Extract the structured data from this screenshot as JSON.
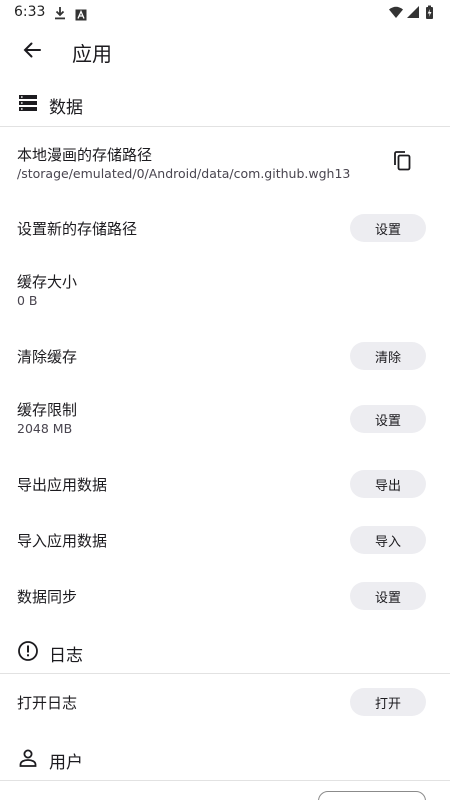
{
  "status_bar": {
    "time": "6:33"
  },
  "app_bar": {
    "title": "应用"
  },
  "sections": {
    "data": {
      "title": "数据"
    },
    "log": {
      "title": "日志"
    },
    "user": {
      "title": "用户"
    }
  },
  "settings": {
    "local_path": {
      "title": "本地漫画的存储路径",
      "value": "/storage/emulated/0/Android/data/com.github.wgh13"
    },
    "new_path": {
      "title": "设置新的存储路径",
      "button": "设置"
    },
    "cache_size": {
      "title": "缓存大小",
      "value": "0 B"
    },
    "clear_cache": {
      "title": "清除缓存",
      "button": "清除"
    },
    "cache_limit": {
      "title": "缓存限制",
      "value": "2048 MB",
      "button": "设置"
    },
    "export_data": {
      "title": "导出应用数据",
      "button": "导出"
    },
    "import_data": {
      "title": "导入应用数据",
      "button": "导入"
    },
    "data_sync": {
      "title": "数据同步",
      "button": "设置"
    },
    "open_log": {
      "title": "打开日志",
      "button": "打开"
    }
  },
  "icons": {
    "status_left": [
      "download-icon",
      "a-box-icon"
    ],
    "status_right": [
      "wifi-icon",
      "signal-icon",
      "battery-icon"
    ],
    "back": "arrow-left-icon",
    "data": "storage-icon",
    "log": "error-outline-icon",
    "user": "person-outline-icon",
    "copy": "copy-icon"
  },
  "colors": {
    "pill_background": "#ededf1",
    "divider": "#e2e2e2",
    "text": "#1c1b1f"
  }
}
